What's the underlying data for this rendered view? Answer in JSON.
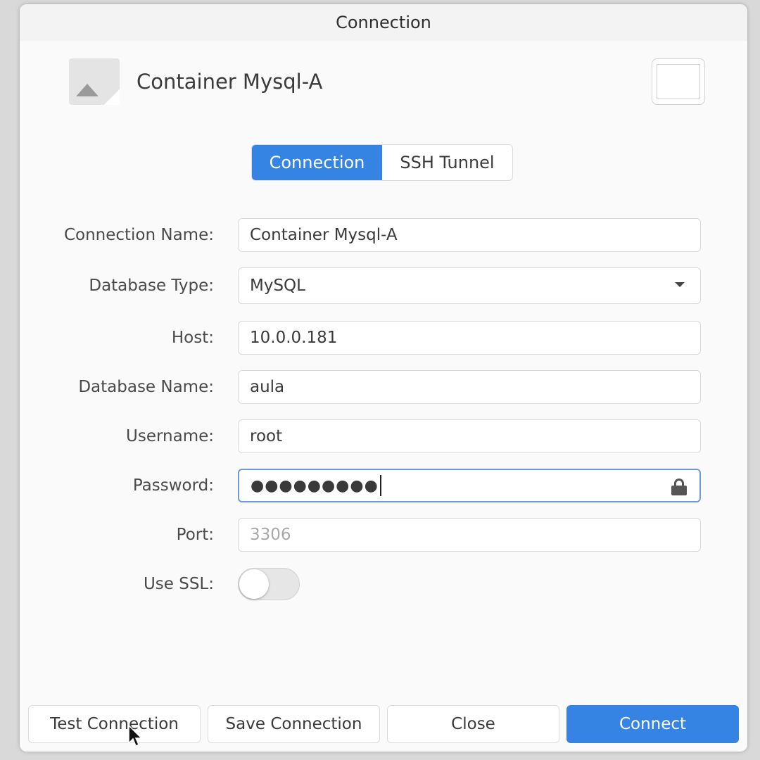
{
  "window": {
    "title": "Connection"
  },
  "header": {
    "connection_title": "Container Mysql-A"
  },
  "tabs": [
    {
      "label": "Connection",
      "active": true
    },
    {
      "label": "SSH Tunnel",
      "active": false
    }
  ],
  "form": {
    "connection_name": {
      "label": "Connection Name:",
      "value": "Container Mysql-A"
    },
    "database_type": {
      "label": "Database Type:",
      "value": "MySQL"
    },
    "host": {
      "label": "Host:",
      "value": "10.0.0.181"
    },
    "database_name": {
      "label": "Database Name:",
      "value": "aula"
    },
    "username": {
      "label": "Username:",
      "value": "root"
    },
    "password": {
      "label": "Password:",
      "value": "●●●●●●●●●"
    },
    "port": {
      "label": "Port:",
      "placeholder": "3306"
    },
    "use_ssl": {
      "label": "Use SSL:",
      "enabled": false
    }
  },
  "footer": {
    "test_label": "Test Connection",
    "save_label": "Save Connection",
    "close_label": "Close",
    "connect_label": "Connect"
  },
  "colors": {
    "accent": "#3584e4",
    "focus_border": "#6e9bd4"
  },
  "icons": [
    "database-icon",
    "color-picker-icon",
    "dropdown-arrow-icon",
    "lock-icon",
    "mouse-cursor-icon"
  ]
}
